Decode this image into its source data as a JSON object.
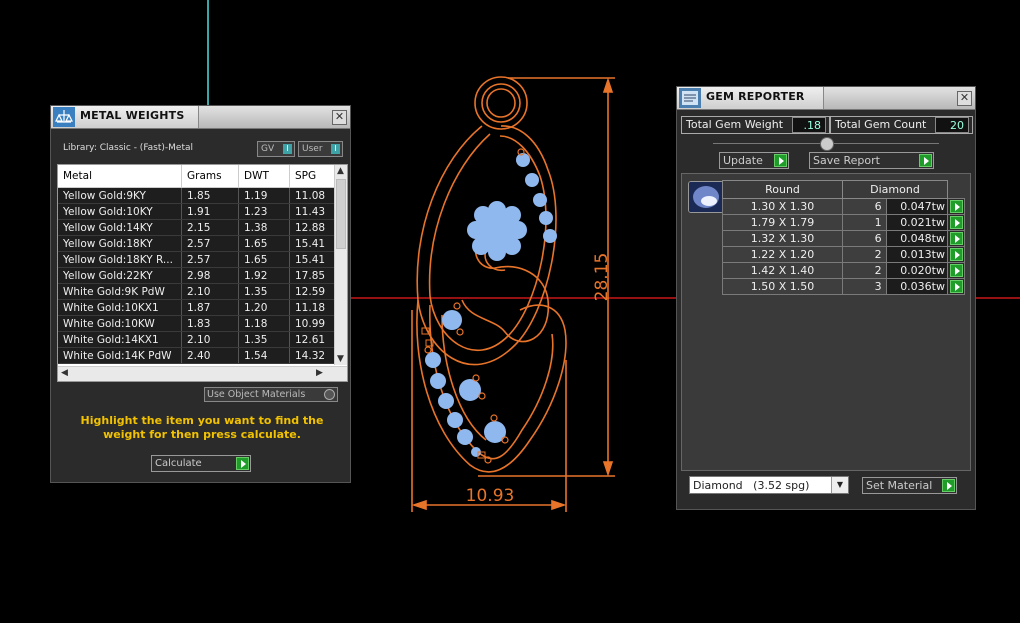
{
  "cad": {
    "dim_height": "28.15",
    "dim_width": "10.93"
  },
  "metal_weights": {
    "title": "METAL WEIGHTS",
    "close": "✕",
    "library_label": "Library: Classic - (Fast)-Metal",
    "toggle_gv": "GV",
    "toggle_user": "User",
    "columns": [
      "Metal",
      "Grams",
      "DWT",
      "SPG"
    ],
    "rows": [
      [
        "Yellow Gold:9KY",
        "1.85",
        "1.19",
        "11.08"
      ],
      [
        "Yellow Gold:10KY",
        "1.91",
        "1.23",
        "11.43"
      ],
      [
        "Yellow Gold:14KY",
        "2.15",
        "1.38",
        "12.88"
      ],
      [
        "Yellow Gold:18KY",
        "2.57",
        "1.65",
        "15.41"
      ],
      [
        "Yellow Gold:18KY R...",
        "2.57",
        "1.65",
        "15.41"
      ],
      [
        "Yellow Gold:22KY",
        "2.98",
        "1.92",
        "17.85"
      ],
      [
        "White Gold:9K PdW",
        "2.10",
        "1.35",
        "12.59"
      ],
      [
        "White Gold:10KX1",
        "1.87",
        "1.20",
        "11.18"
      ],
      [
        "White Gold:10KW",
        "1.83",
        "1.18",
        "10.99"
      ],
      [
        "White Gold:14KX1",
        "2.10",
        "1.35",
        "12.61"
      ],
      [
        "White Gold:14K PdW",
        "2.40",
        "1.54",
        "14.32"
      ]
    ],
    "use_object_materials": "Use Object Materials",
    "hint": "Highlight the item you want to find the weight for then press calculate.",
    "calculate": "Calculate"
  },
  "gem_reporter": {
    "title": "GEM REPORTER",
    "close": "✕",
    "total_weight_label": "Total Gem Weight",
    "total_weight_value": ".18",
    "total_count_label": "Total Gem Count",
    "total_count_value": "20",
    "update": "Update",
    "save_report": "Save Report",
    "col_shape": "Round",
    "col_material": "Diamond",
    "gems": [
      {
        "size": "1.30 X 1.30",
        "count": "6",
        "tw": "0.047tw"
      },
      {
        "size": "1.79 X 1.79",
        "count": "1",
        "tw": "0.021tw"
      },
      {
        "size": "1.32 X 1.30",
        "count": "6",
        "tw": "0.048tw"
      },
      {
        "size": "1.22 X 1.20",
        "count": "2",
        "tw": "0.013tw"
      },
      {
        "size": "1.42 X 1.40",
        "count": "2",
        "tw": "0.020tw"
      },
      {
        "size": "1.50 X 1.50",
        "count": "3",
        "tw": "0.036tw"
      }
    ],
    "material_select": "Diamond   (3.52 spg)",
    "set_material": "Set Material"
  },
  "colors": {
    "background": "#000000",
    "cad_orange": "#e8742a",
    "gem_blue": "#8fb8ee",
    "axis_red": "#c81818",
    "axis_teal": "#3aa6a6",
    "hint_yellow": "#f2c200"
  }
}
